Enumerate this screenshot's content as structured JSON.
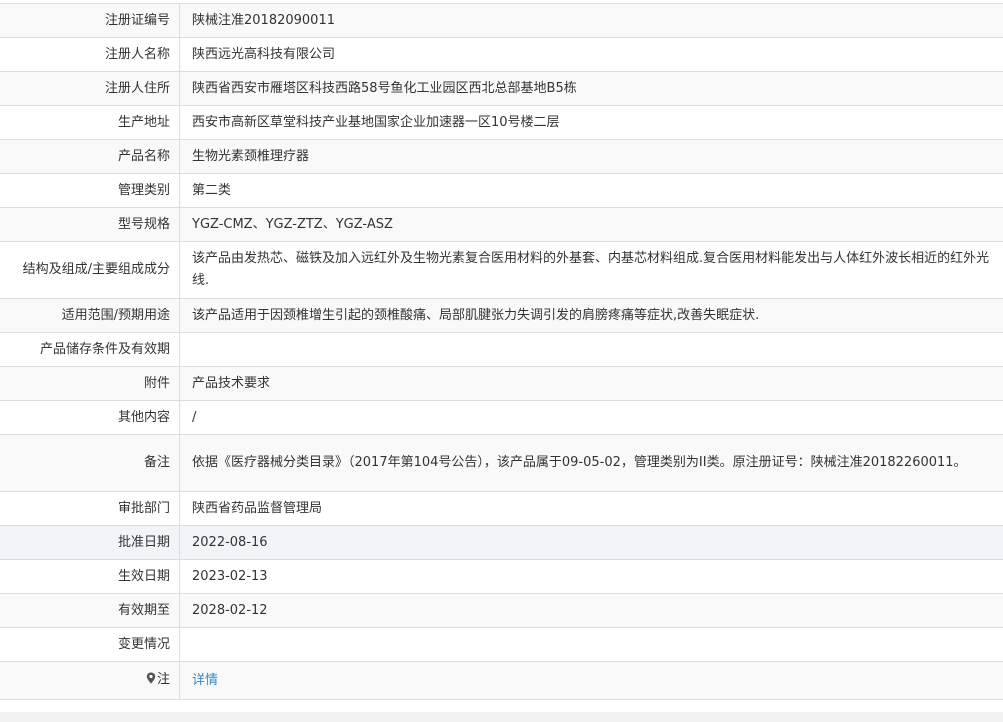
{
  "rows": [
    {
      "label": "注册证编号",
      "value": "陕械注准20182090011"
    },
    {
      "label": "注册人名称",
      "value": "陕西远光高科技有限公司"
    },
    {
      "label": "注册人住所",
      "value": "陕西省西安市雁塔区科技西路58号鱼化工业园区西北总部基地B5栋"
    },
    {
      "label": "生产地址",
      "value": "西安市高新区草堂科技产业基地国家企业加速器一区10号楼二层"
    },
    {
      "label": "产品名称",
      "value": "生物光素颈椎理疗器"
    },
    {
      "label": "管理类别",
      "value": "第二类"
    },
    {
      "label": "型号规格",
      "value": "YGZ-CMZ、YGZ-ZTZ、YGZ-ASZ"
    },
    {
      "label": "结构及组成/主要组成成分",
      "value": "该产品由发热芯、磁铁及加入远红外及生物光素复合医用材料的外基套、内基芯材料组成.复合医用材料能发出与人体红外波长相近的红外光线."
    },
    {
      "label": "适用范围/预期用途",
      "value": "该产品适用于因颈椎增生引起的颈椎酸痛、局部肌腱张力失调引发的肩膀疼痛等症状,改善失眠症状."
    },
    {
      "label": "产品储存条件及有效期",
      "value": ""
    },
    {
      "label": "附件",
      "value": "产品技术要求"
    },
    {
      "label": "其他内容",
      "value": "/"
    },
    {
      "label": "备注",
      "value": "依据《医疗器械分类目录》（2017年第104号公告），该产品属于09-05-02，管理类别为II类。原注册证号：陕械注准20182260011。"
    },
    {
      "label": "审批部门",
      "value": "陕西省药品监督管理局"
    },
    {
      "label": "批准日期",
      "value": "2022-08-16"
    },
    {
      "label": "生效日期",
      "value": "2023-02-13"
    },
    {
      "label": "有效期至",
      "value": "2028-02-12"
    },
    {
      "label": "变更情况",
      "value": ""
    }
  ],
  "note_row": {
    "label": "注",
    "link_text": "详情",
    "icon": "pin-icon"
  },
  "colors": {
    "border": "#dddddd",
    "stripe": "#f9f9f9",
    "highlight": "#f2f4f7",
    "link": "#3a87c8"
  }
}
